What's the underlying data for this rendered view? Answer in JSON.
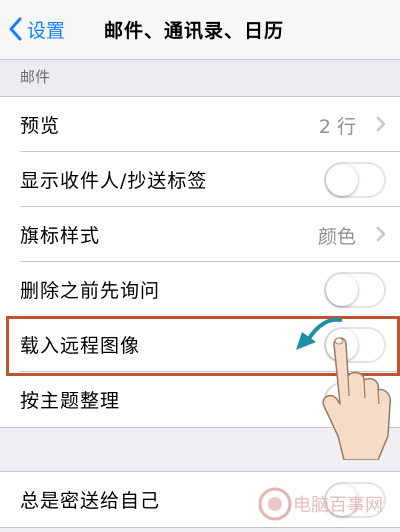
{
  "nav": {
    "back_label": "设置",
    "title": "邮件、通讯录、日历"
  },
  "section": {
    "header": "邮件"
  },
  "group1": {
    "rows": [
      {
        "label": "预览",
        "value": "2 行",
        "type": "link"
      },
      {
        "label": "显示收件人/抄送标签",
        "type": "toggle",
        "on": false
      },
      {
        "label": "旗标样式",
        "value": "颜色",
        "type": "link"
      },
      {
        "label": "删除之前先询问",
        "type": "toggle",
        "on": false
      },
      {
        "label": "载入远程图像",
        "type": "toggle",
        "on": false
      },
      {
        "label": "按主题整理",
        "type": "toggle",
        "on": false
      }
    ]
  },
  "group2": {
    "rows": [
      {
        "label": "总是密送给自己",
        "type": "toggle",
        "on": false
      }
    ]
  },
  "watermark": {
    "text": "电脑百事网"
  },
  "colors": {
    "accent": "#147efb",
    "highlight": "#c0522d",
    "arrow": "#1f8ea8",
    "background": "#efeff4"
  }
}
